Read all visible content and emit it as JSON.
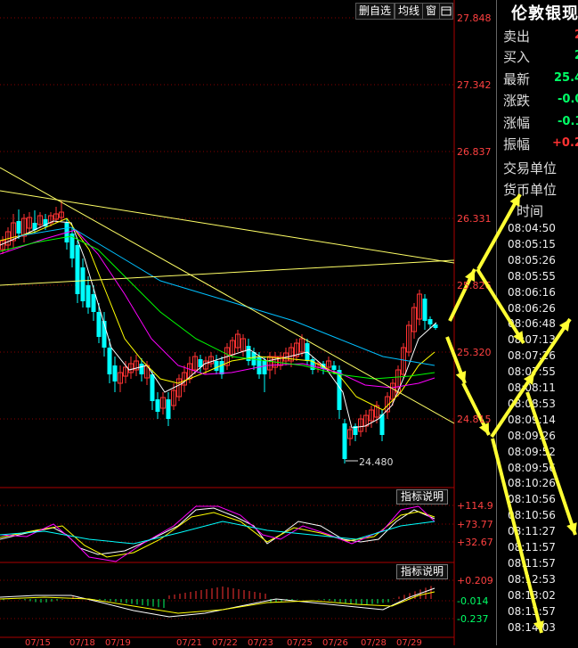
{
  "toolbar": {
    "remove_fav": "删自选",
    "ma_line": "均线",
    "window": "窗"
  },
  "price_axis": [
    "27.848",
    "27.342",
    "26.837",
    "26.331",
    "25.826",
    "25.320",
    "24.815"
  ],
  "low_marker": "24.480",
  "indicator1": {
    "button": "指标说明",
    "levels": [
      "+114.9",
      "+73.77",
      "+32.67"
    ]
  },
  "indicator2": {
    "button": "指标说明",
    "levels": [
      "+0.209",
      "-0.014",
      "-0.237"
    ]
  },
  "x_axis_dates": [
    "07/15",
    "07/18",
    "07/19",
    "07/21",
    "07/22",
    "07/23",
    "07/25",
    "07/26",
    "07/28",
    "07/29"
  ],
  "panel": {
    "title": "伦敦银现",
    "rows": [
      {
        "label": "卖出",
        "value": "2"
      },
      {
        "label": "买入",
        "value": "2"
      },
      {
        "label": "最新",
        "value": "25.4"
      },
      {
        "label": "涨跌",
        "value": "-0.0"
      },
      {
        "label": "涨幅",
        "value": "-0.1"
      },
      {
        "label": "振幅",
        "value": "+0.2"
      },
      {
        "label": "交易单位",
        "value": ""
      },
      {
        "label": "货币单位",
        "value": ""
      }
    ],
    "time_header": "时间",
    "times": [
      "08:04:50",
      "08:05:15",
      "08:05:26",
      "08:05:55",
      "08:06:16",
      "08:06:26",
      "08:06:48",
      "08:07:13",
      "08:07:26",
      "08:07:55",
      "08:08:11",
      "08:08:53",
      "08:09:14",
      "08:09:26",
      "08:09:52",
      "08:09:56",
      "08:10:26",
      "08:10:56",
      "08:10:56",
      "08:11:27",
      "08:11:57",
      "08:11:57",
      "08:12:53",
      "08:13:02",
      "08:13:57",
      "08:14:03"
    ]
  },
  "colors": {
    "up": "#ff3232",
    "down": "#00ffff",
    "ma5": "#ffffff",
    "ma10": "#ffff00",
    "ma20": "#ff00ff",
    "ma30": "#00ff00",
    "ma60": "#00c0ff"
  }
}
